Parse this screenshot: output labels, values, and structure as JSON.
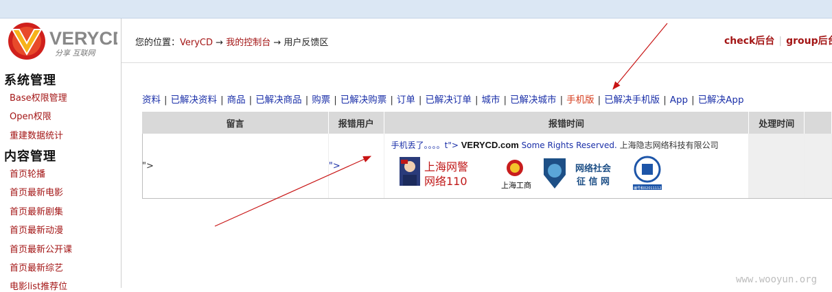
{
  "logo": {
    "text": "VERYCD",
    "slogan": "分享 互联网"
  },
  "sidebar": {
    "sections": [
      {
        "title": "系统管理",
        "items": [
          "Base权限管理",
          "Open权限",
          "重建数据统计"
        ]
      },
      {
        "title": "内容管理",
        "items": [
          "首页轮播",
          "首页最新电影",
          "首页最新剧集",
          "首页最新动漫",
          "首页最新公开课",
          "首页最新综艺",
          "电影list推荐位"
        ]
      }
    ]
  },
  "breadcrumb": {
    "prefix": "您的位置：",
    "items": [
      "VeryCD",
      "我的控制台",
      "用户反馈区"
    ],
    "sep": "→"
  },
  "header_links": [
    "check后台",
    "group后台"
  ],
  "tabs": [
    "资料",
    "已解决资料",
    "商品",
    "已解决商品",
    "购票",
    "已解决购票",
    "订单",
    "已解决订单",
    "城市",
    "已解决城市",
    "手机版",
    "已解决手机版",
    "App",
    "已解决App"
  ],
  "active_tab": "手机版",
  "table": {
    "headers": [
      "留言",
      "报错用户",
      "报错时间",
      "处理时间",
      ""
    ],
    "row": {
      "message": "\">",
      "user": "\">",
      "time_text_1": "手机丢了。。。。t\">",
      "time_brand": "VERYCD.com",
      "time_text_2": "Some Rights Reserved.",
      "time_text_3": "上海隐志网络科技有限公司",
      "badge_police_1": "上海网警",
      "badge_police_2": "网络110",
      "badge_aic": "上海工商",
      "badge_social_1": "网络社会",
      "badge_social_2": "征 信 网",
      "badge_id": "编号和020111125"
    }
  },
  "watermark": "www.wooyun.org",
  "colors": {
    "link_red": "#a31515",
    "link_blue": "#1a2fa8",
    "active_orange": "#d53a1a",
    "arrow": "#c81414",
    "topbar": "#dbe7f4"
  }
}
